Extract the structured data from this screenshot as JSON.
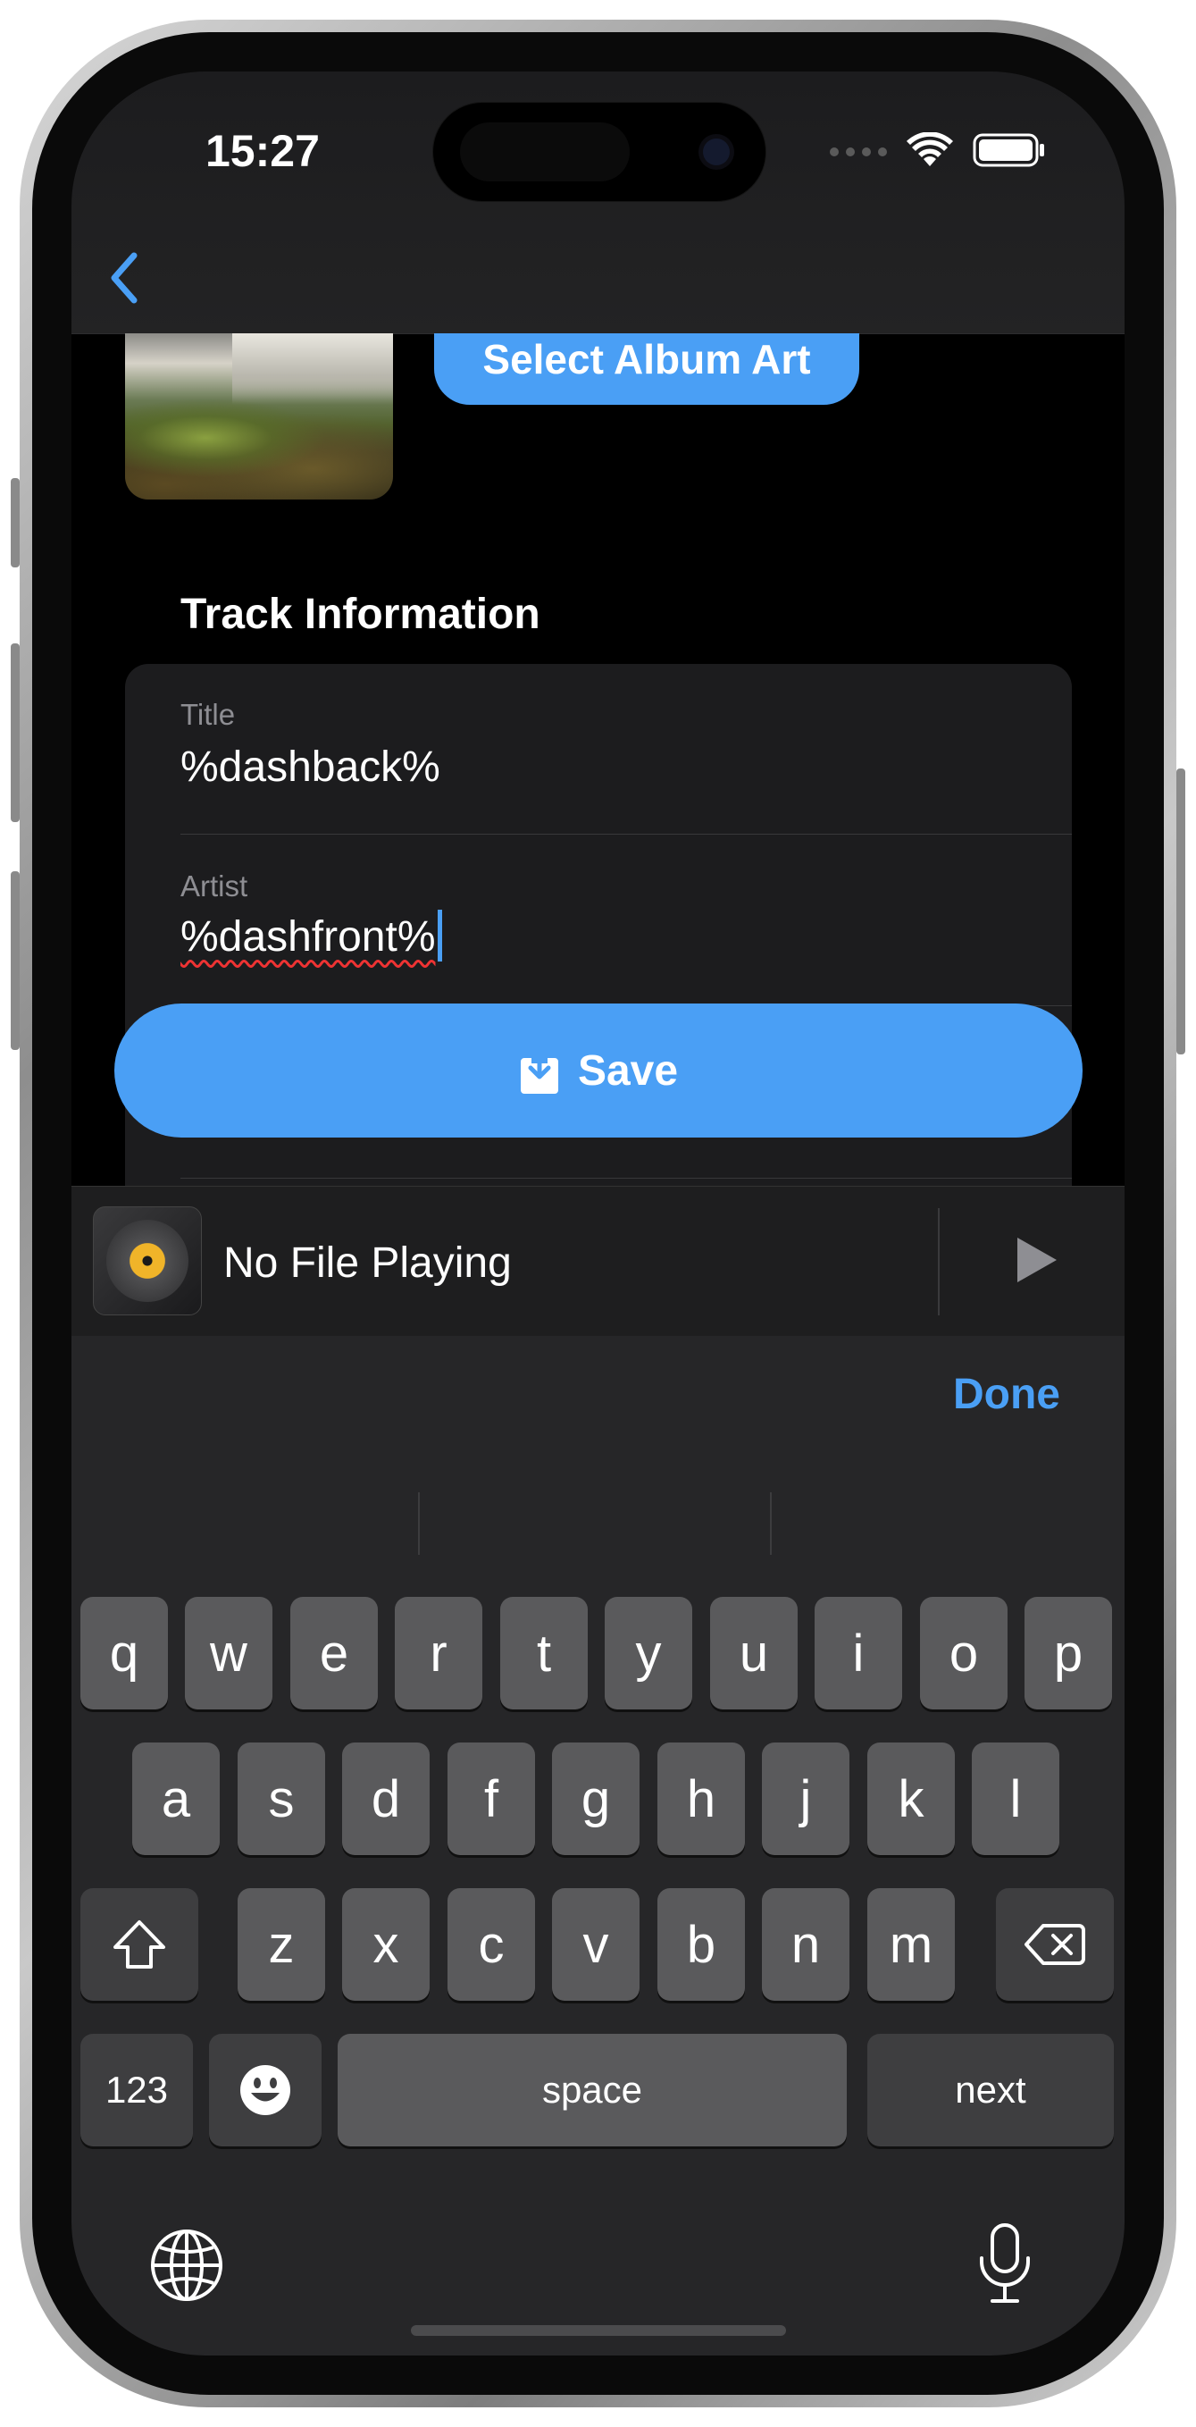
{
  "status_bar": {
    "time": "15:27"
  },
  "nav": {
    "back_label": ""
  },
  "album_art": {
    "button_label": "Select Album Art"
  },
  "track_info": {
    "header": "Track Information",
    "title_label": "Title",
    "title_value": "%dashback%",
    "artist_label": "Artist",
    "artist_value": "%dashfront%"
  },
  "save_button": {
    "label": "Save"
  },
  "mini_player": {
    "title": "No File Playing"
  },
  "keyboard": {
    "done_label": "Done",
    "row1": [
      "q",
      "w",
      "e",
      "r",
      "t",
      "y",
      "u",
      "i",
      "o",
      "p"
    ],
    "row2": [
      "a",
      "s",
      "d",
      "f",
      "g",
      "h",
      "j",
      "k",
      "l"
    ],
    "row3": [
      "z",
      "x",
      "c",
      "v",
      "b",
      "n",
      "m"
    ],
    "numbers_label": "123",
    "space_label": "space",
    "next_label": "next"
  },
  "colors": {
    "accent": "#4a9ff5",
    "background": "#000000",
    "card": "#1c1c1e",
    "key": "#5a5a5c"
  },
  "icons": [
    "chevron-left-icon",
    "wifi-icon",
    "battery-icon",
    "download-icon",
    "disc-icon",
    "play-icon",
    "shift-icon",
    "delete-icon",
    "emoji-icon",
    "globe-icon",
    "microphone-icon"
  ]
}
